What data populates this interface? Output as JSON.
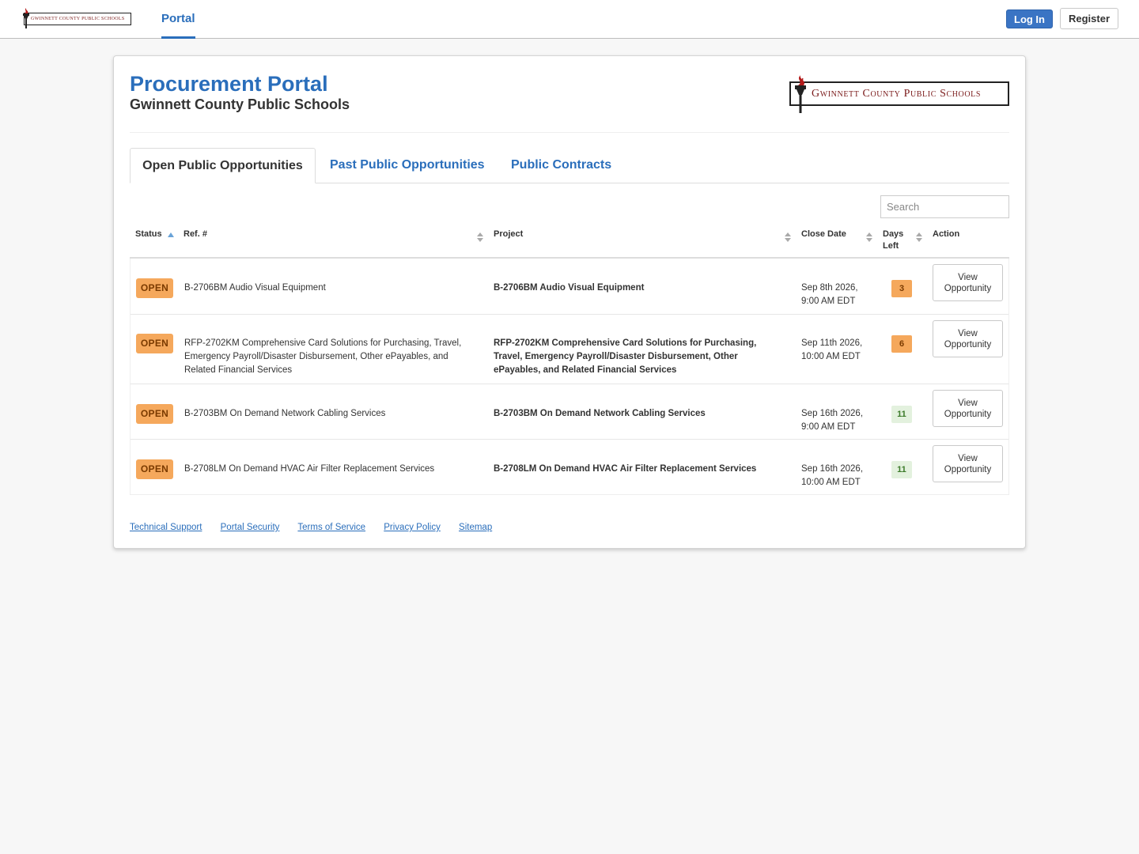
{
  "nav": {
    "logo_text": "Gwinnett County Public Schools",
    "portal_tab": "Portal",
    "login_label": "Log In",
    "register_label": "Register"
  },
  "header": {
    "title": "Procurement Portal",
    "subtitle": "Gwinnett County Public Schools",
    "logo_text": "Gwinnett County Public Schools"
  },
  "tabs": [
    {
      "label": "Open Public Opportunities",
      "active": true
    },
    {
      "label": "Past Public Opportunities",
      "active": false
    },
    {
      "label": "Public Contracts",
      "active": false
    }
  ],
  "search": {
    "placeholder": "Search",
    "value": ""
  },
  "table": {
    "headers": {
      "status": "Status",
      "ref": "Ref. #",
      "project": "Project",
      "close_date": "Close Date",
      "days_left_1": "Days",
      "days_left_2": "Left",
      "action": "Action"
    },
    "rows": [
      {
        "status": "OPEN",
        "ref": "B-2706BM Audio Visual Equipment",
        "project": "B-2706BM Audio Visual Equipment",
        "close_date_1": "Sep 8th 2026,",
        "close_date_2": "9:00 AM EDT",
        "days_left": "3",
        "action_1": "View",
        "action_2": "Opportunity"
      },
      {
        "status": "OPEN",
        "ref": "RFP-2702KM Comprehensive Card Solutions for Purchasing, Travel, Emergency Payroll/Disaster Disbursement, Other ePayables, and Related Financial Services",
        "project": "RFP-2702KM Comprehensive Card Solutions for Purchasing, Travel, Emergency Payroll/Disaster Disbursement, Other ePayables, and Related Financial Services",
        "close_date_1": "Sep 11th 2026,",
        "close_date_2": "10:00 AM EDT",
        "days_left": "6",
        "action_1": "View",
        "action_2": "Opportunity"
      },
      {
        "status": "OPEN",
        "ref": "B-2703BM On Demand Network Cabling Services",
        "project": "B-2703BM On Demand Network Cabling Services",
        "close_date_1": "Sep 16th 2026,",
        "close_date_2": "9:00 AM EDT",
        "days_left": "11",
        "action_1": "View",
        "action_2": "Opportunity"
      },
      {
        "status": "OPEN",
        "ref": "B-2708LM On Demand HVAC Air Filter Replacement Services",
        "project": "B-2708LM On Demand HVAC Air Filter Replacement Services",
        "close_date_1": "Sep 16th 2026,",
        "close_date_2": "10:00 AM EDT",
        "days_left": "11",
        "action_1": "View",
        "action_2": "Opportunity"
      }
    ]
  },
  "footer": {
    "links": [
      "Technical Support",
      "Portal Security",
      "Terms of Service",
      "Privacy Policy",
      "Sitemap"
    ]
  },
  "colors": {
    "brand_blue": "#2a6ebb",
    "open_badge": "#f5a85c",
    "days_ok": "#e3f1de",
    "logo_maroon": "#7a1a1a"
  }
}
